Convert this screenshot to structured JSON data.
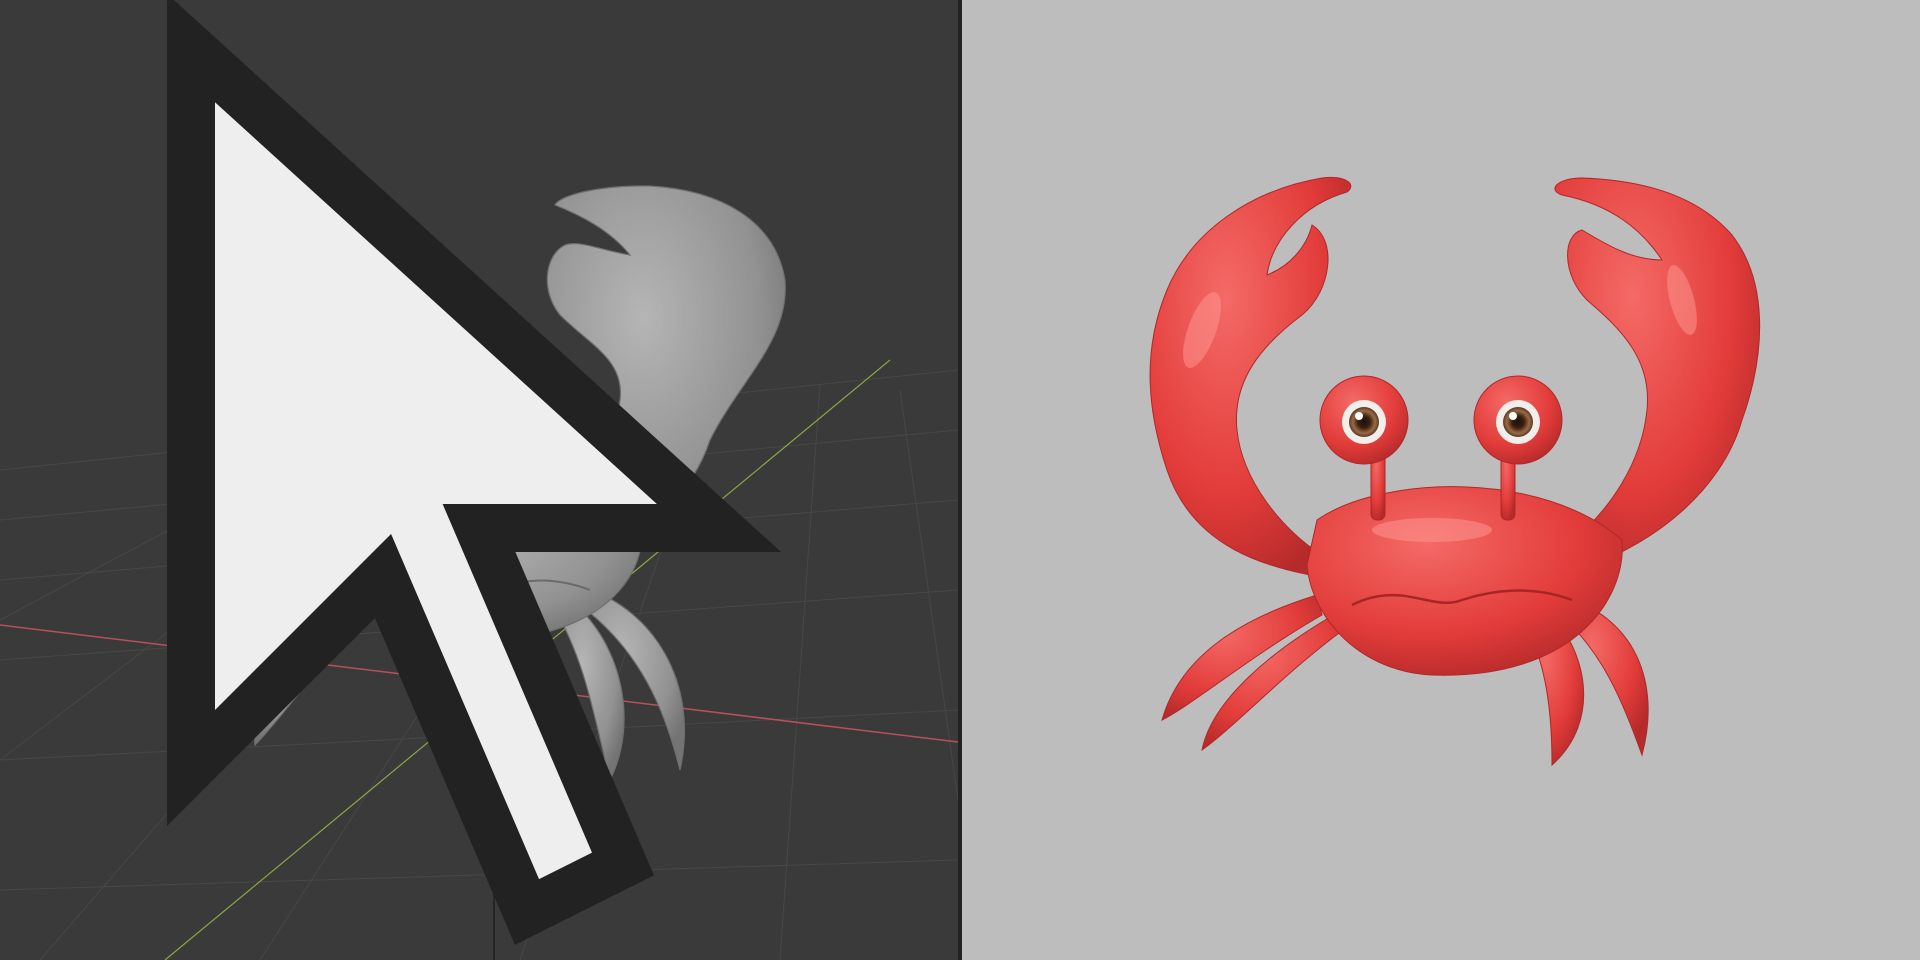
{
  "viewport": {
    "background": "#3a3a3a",
    "grid_color": "#4a4a4a",
    "x_axis_color": "#c0505a",
    "y_axis_color": "#8fbd4a",
    "z_axis_color": "#1a1a1a",
    "model_color": "#9a9a9a",
    "icons": [
      "3d-cursor-icon",
      "mouse-pointer-icon"
    ]
  },
  "render": {
    "background": "#bdbdbd",
    "model_color": "#e8403e",
    "eye_iris_color": "#8a5a3a"
  }
}
